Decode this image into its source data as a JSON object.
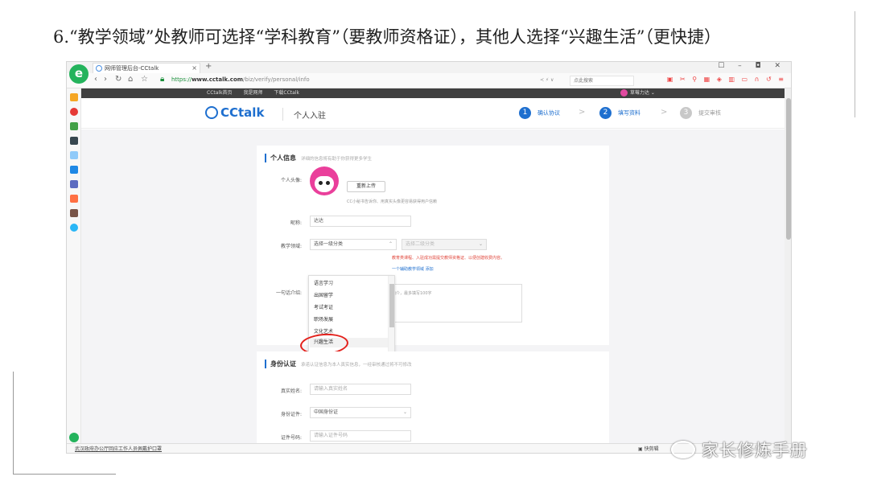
{
  "heading": "6.“教学领域”处教师可选择“学科教育”（要教师资格证），其他人选择“兴趣生活”（更快捷）",
  "browser": {
    "tab_title": "网师管理后台-CCtalk",
    "tab_close": "×",
    "new_tab": "+",
    "window_controls": "☐ – ◘ ✕",
    "url_scheme": "https://",
    "url_host": "www.cctalk.com",
    "url_path": "/biz/verify/personal/info",
    "addr_right": "≺ ⚡ ∨",
    "search_placeholder": "点此搜索",
    "status_left": "武汉政府办公厅回应工作人员佩戴护口罩",
    "status_right": "▣ 快剪辑"
  },
  "site": {
    "topnav": [
      "CCtalk首页",
      "我是网师",
      "下载CCtalk"
    ],
    "user_name": "草莓力达",
    "logo_text": "CCtalk",
    "header_title": "个人入驻",
    "steps": [
      {
        "num": "1",
        "label": "确认协议",
        "color": "#1e6fcf"
      },
      {
        "num": "2",
        "label": "填写资料",
        "color": "#1e6fcf"
      },
      {
        "num": "3",
        "label": "提交审核",
        "color": "#c8c8c8"
      }
    ],
    "step_arrow": ">"
  },
  "personal": {
    "title": "个人信息",
    "desc": "详细的信息将有助于你获得更多学生",
    "avatar_label": "个人头像:",
    "reupload": "重新上传",
    "avatar_hint": "CC小秘书告诉你、用真实头像更容易获得用户信赖",
    "nickname_label": "昵称:",
    "nickname_value": "达达",
    "domain_label": "教学领域:",
    "domain_select": "选择一级分类",
    "domain_select2": "选择二级分类",
    "domain_hint_red": "教育类课程、入驻成功需提交教师资格证、以便创建收费内容。",
    "domain_hint_blue": "一个辅助教学领域 添加",
    "intro_label": "一句话介绍:",
    "intro_hint": "简介，最多填写100字",
    "options": [
      "语言学习",
      "出国留学",
      "考试考证",
      "职场发展",
      "文化艺术",
      "兴趣生活"
    ],
    "selected_option": "兴趣生活"
  },
  "identity": {
    "title": "身份认证",
    "desc": "承诺认证信息为本人真实信息，一经审核通过将不可修改",
    "realname_label": "真实姓名:",
    "realname_placeholder": "请输入真实姓名",
    "idtype_label": "身份证件:",
    "idtype_value": "中国身份证",
    "idno_label": "证件号码:",
    "idno_placeholder": "请输入证件号码"
  },
  "watermark": "家长修炼手册",
  "colors": {
    "brand": "#1e6fcf",
    "highlight_circle": "#e3211c",
    "browser_logo": "#24b35c"
  }
}
